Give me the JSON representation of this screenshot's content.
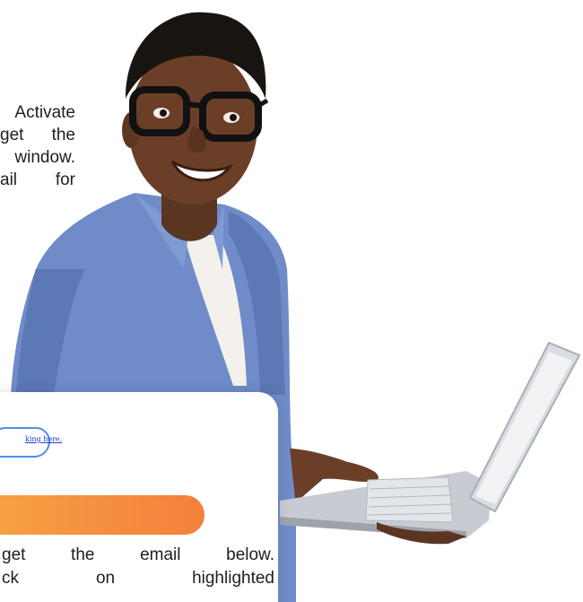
{
  "intro": {
    "line1": "Activate",
    "line2_a": "get",
    "line2_b": "the",
    "line3": "window.",
    "line4_a": "ail",
    "line4_b": "for"
  },
  "card": {
    "link_text": "king here.",
    "text_line1_words": [
      "get",
      "the",
      "email",
      "below."
    ],
    "text_line2_words": [
      "ck",
      "on",
      "highlighted"
    ]
  },
  "colors": {
    "accent_orange_start": "#f7a344",
    "accent_orange_end": "#f37f3b",
    "shirt_blue": "#6f8cc9",
    "link_blue": "#4b8fe8"
  }
}
